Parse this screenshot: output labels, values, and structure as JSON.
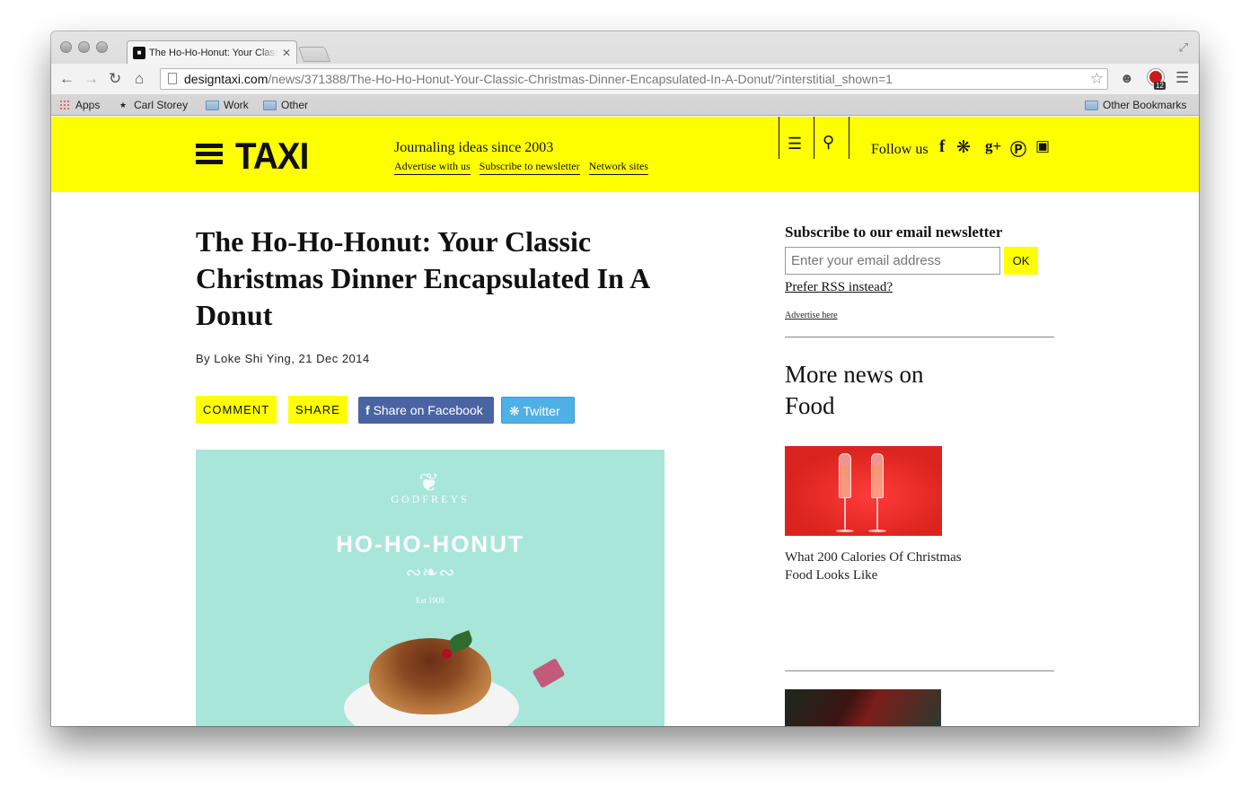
{
  "browser": {
    "tab_title": "The Ho-Ho-Honut: Your Classic Christmas Dinner Encapsulated In A Donut",
    "tab_close": "✕",
    "url_host": "designtaxi.com",
    "url_path": "/news/371388/The-Ho-Ho-Honut-Your-Classic-Christmas-Dinner-Encapsulated-In-A-Donut/?interstitial_shown=1",
    "extension_badge": "12",
    "bookmarks": [
      "Apps",
      "Carl Storey",
      "Work",
      "Other"
    ],
    "other_bookmarks": "Other Bookmarks"
  },
  "header": {
    "logo": "TAXI",
    "tagline": "Journaling ideas since 2003",
    "links": [
      "Advertise with us",
      "Subscribe to newsletter",
      "Network sites"
    ],
    "follow_label": "Follow us",
    "social_icons": [
      "facebook-icon",
      "twitter-icon",
      "google-plus-icon",
      "pinterest-icon",
      "linkedin-icon"
    ],
    "accent_color": "#ffff00"
  },
  "article": {
    "title": "The Ho-Ho-Honut: Your Classic Christmas Dinner Encapsulated In A Donut",
    "byline": "By Loke Shi Ying, 21 Dec 2014",
    "buttons": {
      "comment": "COMMENT",
      "share": "SHARE",
      "facebook": "Share on Facebook",
      "twitter": "Twitter"
    },
    "hero": {
      "brand": "GODFREYS",
      "product": "HO-HO-HONUT",
      "est": "Est 1900",
      "background": "#a8e6da"
    }
  },
  "sidebar": {
    "newsletter_title": "Subscribe to our email newsletter",
    "email_placeholder": "Enter your email address",
    "ok_label": "OK",
    "rss_link": "Prefer RSS instead?",
    "advertise": "Advertise here",
    "more_title": "More news on Food",
    "news_items": [
      {
        "caption": "What 200 Calories Of Christmas Food Looks Like"
      }
    ]
  }
}
